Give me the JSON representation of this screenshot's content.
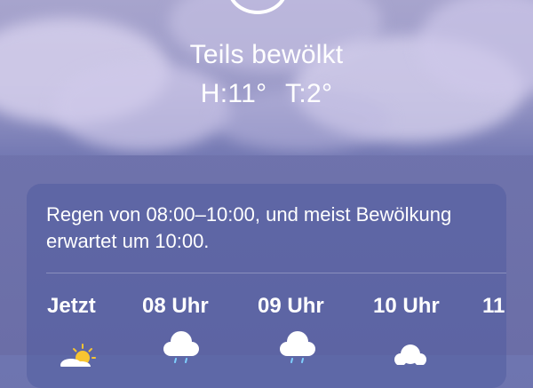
{
  "current": {
    "condition": "Teils bewölkt",
    "high": "H:11°",
    "low": "T:2°",
    "icon": "sun-outline-icon"
  },
  "forecast": {
    "summary": "Regen von 08:00–10:00, und meist Bewölkung erwartet um 10:00.",
    "hours": [
      {
        "label": "Jetzt",
        "icon": "partly-sunny-icon"
      },
      {
        "label": "08 Uhr",
        "icon": "rain-cloud-icon"
      },
      {
        "label": "09 Uhr",
        "icon": "rain-cloud-icon"
      },
      {
        "label": "10 Uhr",
        "icon": "cloud-icon"
      },
      {
        "label": "11",
        "icon": "cloud-icon"
      }
    ]
  },
  "colors": {
    "card_bg": "#525ca0",
    "sky": "#9c9bc8",
    "sun": "#f7c531"
  }
}
